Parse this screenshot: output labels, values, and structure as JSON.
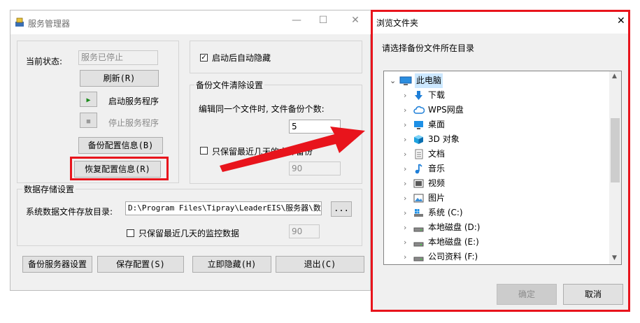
{
  "main_window": {
    "title": "服务管理器",
    "status_label": "当前状态:",
    "status_value": "服务已停止",
    "refresh_button": "刷新(R)",
    "start_service_label": "启动服务程序",
    "stop_service_label": "停止服务程序",
    "backup_config_button": "备份配置信息(B)",
    "restore_config_button": "恢复配置信息(R)",
    "auto_hide_label": "启动后自动隐藏",
    "auto_hide_checked": true,
    "backup_cleanup": {
      "legend": "备份文件清除设置",
      "count_label": "编辑同一个文件时, 文件备份个数:",
      "count_value": "5",
      "keep_days_label": "只保留最近几天的文件备份",
      "keep_days_checked": false,
      "keep_days_value": "90"
    },
    "data_storage": {
      "legend": "数据存储设置",
      "dir_label": "系统数据文件存放目录:",
      "dir_value": "D:\\Program Files\\Tipray\\LeaderEIS\\服务器\\数据\\",
      "browse_button": "...",
      "keep_monitor_label": "只保留最近几天的监控数据",
      "keep_monitor_checked": false,
      "keep_monitor_value": "90"
    },
    "bottom_buttons": {
      "backup_server": "备份服务器设置",
      "save_config": "保存配置(S)",
      "hide_now": "立即隐藏(H)",
      "exit": "退出(C)"
    }
  },
  "browse_dialog": {
    "title": "浏览文件夹",
    "close_glyph": "✕",
    "prompt": "请选择备份文件所在目录",
    "tree_root": "此电脑",
    "tree_items": [
      {
        "label": "下载",
        "icon": "download-icon"
      },
      {
        "label": "WPS网盘",
        "icon": "cloud-icon"
      },
      {
        "label": "桌面",
        "icon": "desktop-icon"
      },
      {
        "label": "3D 对象",
        "icon": "cube-icon"
      },
      {
        "label": "文档",
        "icon": "document-icon"
      },
      {
        "label": "音乐",
        "icon": "music-icon"
      },
      {
        "label": "视频",
        "icon": "video-icon"
      },
      {
        "label": "图片",
        "icon": "picture-icon"
      },
      {
        "label": "系统 (C:)",
        "icon": "system-drive-icon"
      },
      {
        "label": "本地磁盘 (D:)",
        "icon": "drive-icon"
      },
      {
        "label": "本地磁盘 (E:)",
        "icon": "drive-icon"
      },
      {
        "label": "公司资料 (F:)",
        "icon": "drive-icon"
      }
    ],
    "ok_button": "确定",
    "cancel_button": "取消"
  },
  "colors": {
    "highlight_red": "#e8141c",
    "selection_blue": "#cce8ff",
    "window_bg": "#f0f0f0"
  }
}
